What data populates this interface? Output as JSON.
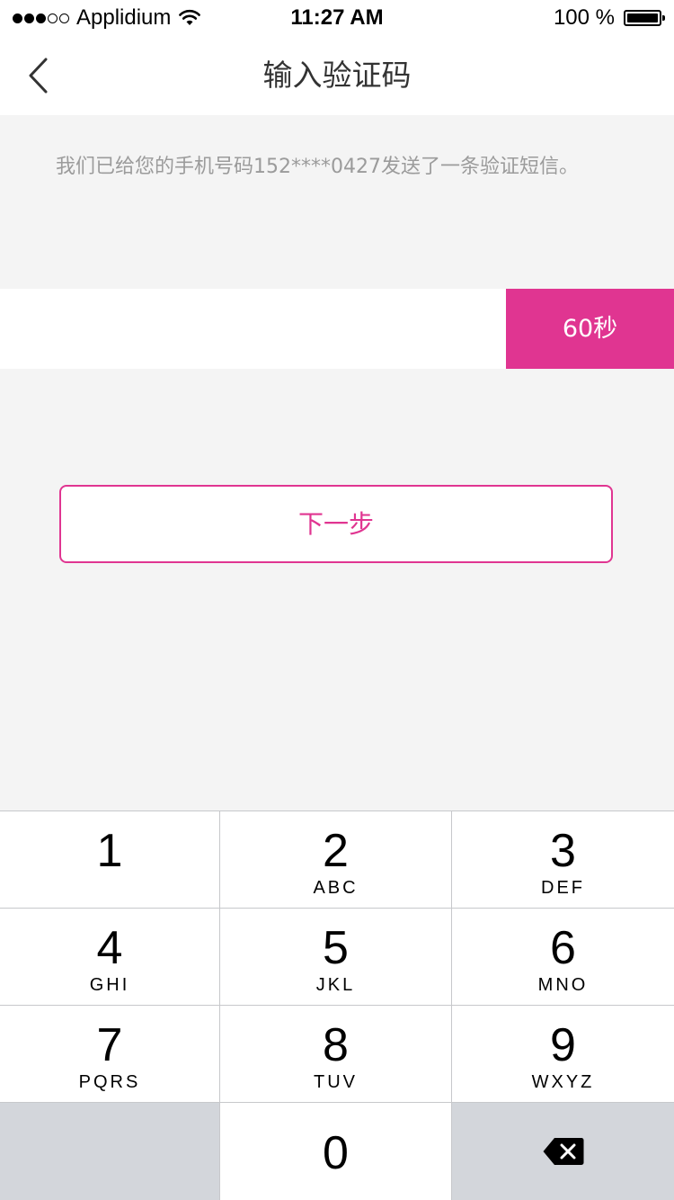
{
  "status_bar": {
    "carrier": "Applidium",
    "time": "11:27 AM",
    "battery_percent": "100 %",
    "signal_bars_filled": 3,
    "signal_bars_total": 5,
    "icons": [
      "signal-dots-icon",
      "wifi-icon",
      "battery-icon"
    ]
  },
  "nav": {
    "title": "输入验证码",
    "back_icon": "chevron-left-icon"
  },
  "message": "我们已给您的手机号码152****0427发送了一条验证短信。",
  "code_input": {
    "value": "",
    "placeholder": ""
  },
  "countdown": {
    "label": "60秒"
  },
  "next_button": {
    "label": "下一步"
  },
  "keypad": {
    "keys": [
      {
        "digit": "1",
        "letters": ""
      },
      {
        "digit": "2",
        "letters": "ABC"
      },
      {
        "digit": "3",
        "letters": "DEF"
      },
      {
        "digit": "4",
        "letters": "GHI"
      },
      {
        "digit": "5",
        "letters": "JKL"
      },
      {
        "digit": "6",
        "letters": "MNO"
      },
      {
        "digit": "7",
        "letters": "PQRS"
      },
      {
        "digit": "8",
        "letters": "TUV"
      },
      {
        "digit": "9",
        "letters": "WXYZ"
      },
      {
        "digit": "0",
        "letters": ""
      }
    ],
    "delete_icon": "backspace-icon"
  },
  "colors": {
    "accent": "#e03591",
    "background": "#f4f4f4",
    "message_text": "#9b9b9b",
    "title_text": "#333333",
    "keypad_dark_key": "#d3d6db"
  }
}
